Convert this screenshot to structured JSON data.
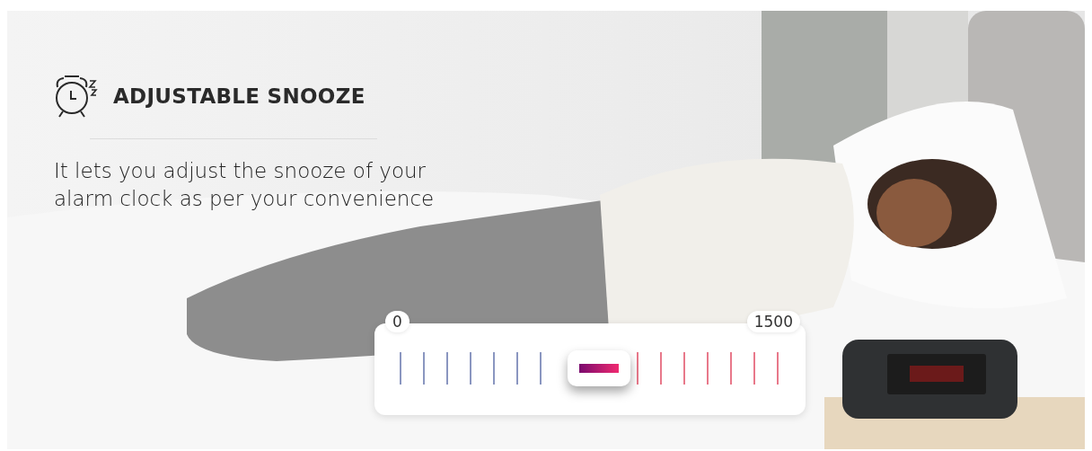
{
  "heading": {
    "title": "ADJUSTABLE SNOOZE"
  },
  "description": "It lets you adjust the snooze of your alarm clock as per your convenience",
  "slider": {
    "min_label": "0",
    "max_label": "1500",
    "level": 0.5
  }
}
